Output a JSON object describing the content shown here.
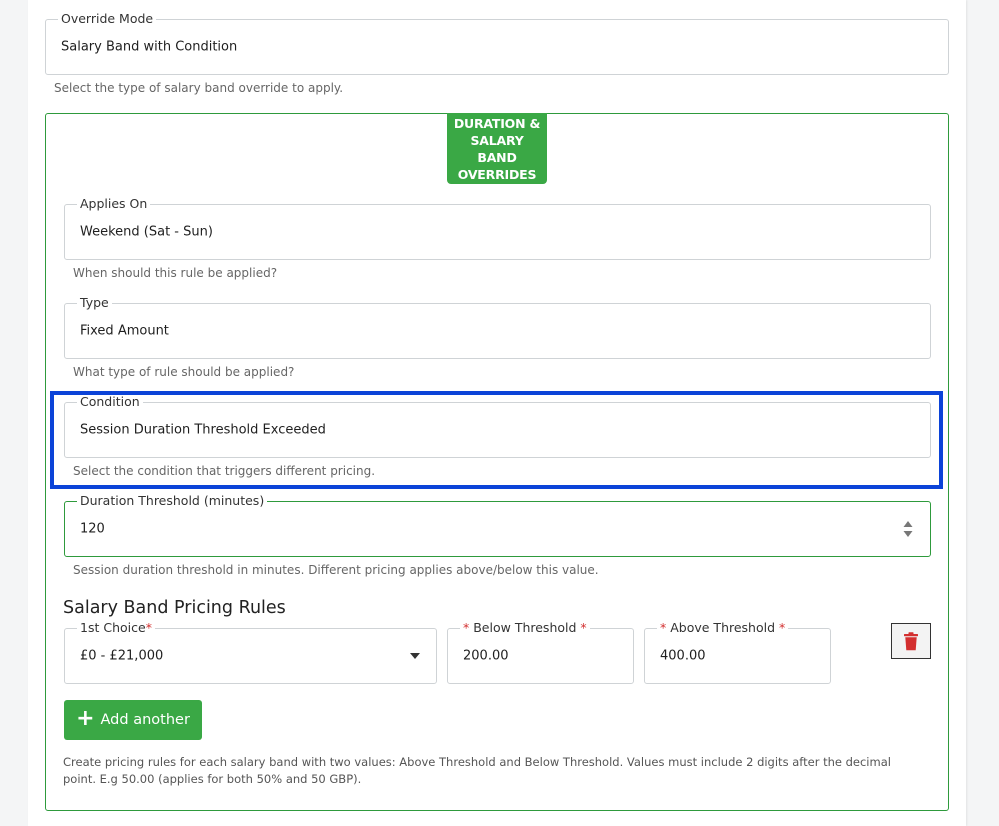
{
  "override_mode": {
    "legend": "Override Mode",
    "value": "Salary Band with Condition",
    "helper": "Select the type of salary band override to apply."
  },
  "section": {
    "badge": "DURATION & SALARY BAND OVERRIDES"
  },
  "applies_on": {
    "legend": "Applies On",
    "value": "Weekend (Sat - Sun)",
    "helper": "When should this rule be applied?"
  },
  "type": {
    "legend": "Type",
    "value": "Fixed Amount",
    "helper": "What type of rule should be applied?"
  },
  "condition": {
    "legend": "Condition",
    "value": "Session Duration Threshold Exceeded",
    "helper": "Select the condition that triggers different pricing."
  },
  "duration_threshold": {
    "legend": "Duration Threshold (minutes)",
    "value": "120",
    "helper": "Session duration threshold in minutes. Different pricing applies above/below this value."
  },
  "pricing": {
    "title": "Salary Band Pricing Rules",
    "rows": [
      {
        "choice_legend": "1st Choice",
        "choice_value": "£0 - £21,000",
        "below_legend": "Below Threshold",
        "below_value": "200.00",
        "above_legend": "Above Threshold",
        "above_value": "400.00",
        "required_mark": "*"
      }
    ],
    "add_label": "Add another",
    "note": "Create pricing rules for each salary band with two values: Above Threshold and Below Threshold. Values must include 2 digits after the decimal point. E.g 50.00 (applies for both 50% and 50 GBP)."
  },
  "colors": {
    "accent_green": "#3aa845",
    "highlight_blue": "#0b43d8",
    "delete_red": "#d32f2f"
  },
  "icons": {
    "plus": "plus-icon",
    "delete": "trash-icon",
    "dropdown": "caret-down-icon",
    "spinner": "spinner-arrows-icon"
  }
}
